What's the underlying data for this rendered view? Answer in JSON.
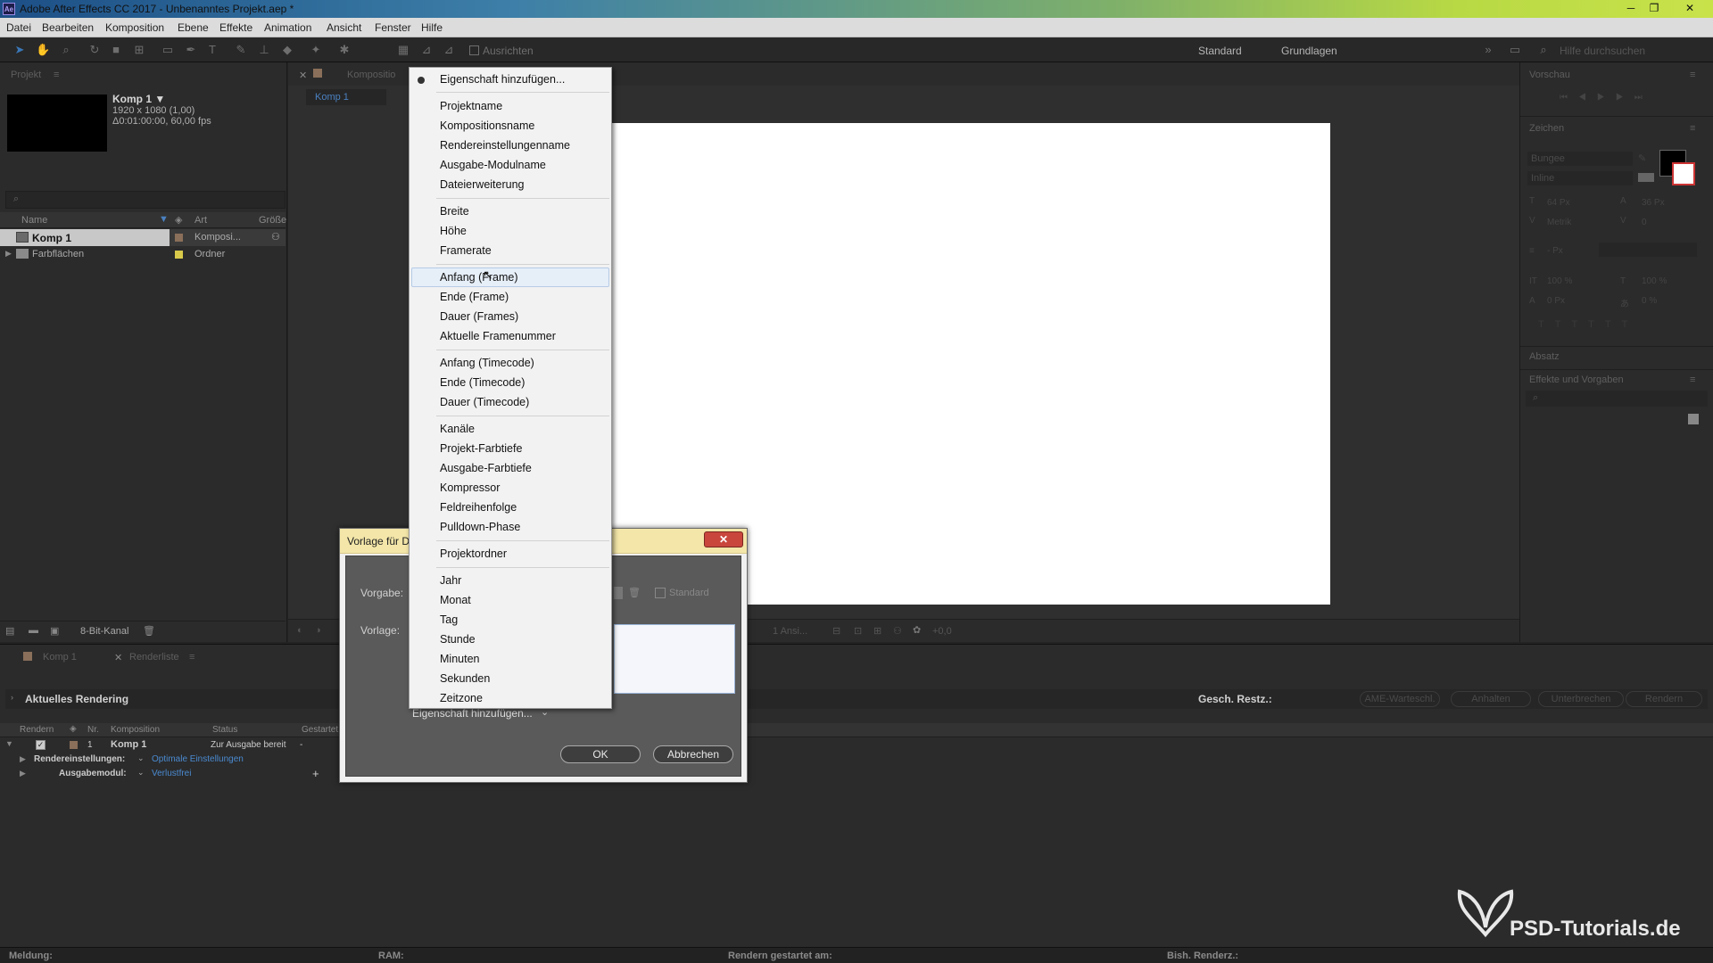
{
  "window": {
    "title": "Adobe After Effects CC 2017 - Unbenanntes Projekt.aep *",
    "app_icon": "Ae"
  },
  "menubar": [
    "Datei",
    "Bearbeiten",
    "Komposition",
    "Ebene",
    "Effekte",
    "Animation",
    "Ansicht",
    "Fenster",
    "Hilfe"
  ],
  "toolbar": {
    "ausrichten": "Ausrichten",
    "workspace_standard": "Standard",
    "workspace_grundlagen": "Grundlagen",
    "help_placeholder": "Hilfe durchsuchen"
  },
  "project": {
    "title": "Projekt",
    "comp_name": "Komp 1 ▼",
    "comp_size": "1920 x 1080 (1,00)",
    "comp_duration": "Δ0:01:00:00, 60,00 fps",
    "col_name": "Name",
    "col_art": "Art",
    "col_groesse": "Größe",
    "rows": [
      {
        "name": "Komp 1",
        "type": "Komposi...",
        "color": "#8a6f5a"
      },
      {
        "name": "Farbflächen",
        "type": "Ordner",
        "color": "#d8c94a"
      }
    ],
    "bit_depth": "8-Bit-Kanal"
  },
  "viewer": {
    "tab_label": "Kompositio",
    "comp_tab": "Komp 1",
    "zoom_view": "1 Ansi...",
    "exposure": "+0,0"
  },
  "right": {
    "vorschau": "Vorschau",
    "zeichen": "Zeichen",
    "font": "Bungee",
    "style": "Inline",
    "size": "64 Px",
    "leading": "36 Px",
    "kerning": "Metrik",
    "tracking": "0",
    "stroke": "- Px",
    "vscale": "100 %",
    "hscale": "100 %",
    "baseline": "0 Px",
    "tsume": "0 %",
    "absatz": "Absatz",
    "effekte": "Effekte und Vorgaben"
  },
  "renderq": {
    "tab1": "Komp 1",
    "tab2": "Renderliste",
    "current": "Aktuelles Rendering",
    "rest": "Gesch. Restz.:",
    "btn_ame": "AME-Warteschl.",
    "btn_anhalten": "Anhalten",
    "btn_unterbrechen": "Unterbrechen",
    "btn_rendern": "Rendern",
    "col_render": "Rendern",
    "col_nr": "Nr.",
    "col_komposition": "Komposition",
    "col_status": "Status",
    "col_gestartet": "Gestartet",
    "item_nr": "1",
    "item_name": "Komp 1",
    "item_status": "Zur Ausgabe bereit",
    "item_dash": "-",
    "render_settings_label": "Rendereinstellungen:",
    "render_settings_value": "Optimale Einstellungen",
    "output_label": "Ausgabemodul:",
    "output_value": "Verlustfrei"
  },
  "status": {
    "meldung": "Meldung:",
    "ram": "RAM:",
    "gestartet": "Rendern gestartet am:",
    "bisher": "Bish. Renderz.:"
  },
  "dialog": {
    "title": "Vorlage für D",
    "vorgabe_label": "Vorgabe:",
    "vorlage_label": "Vorlage:",
    "standard_label": "Standard",
    "add_property": "Eigenschaft hinzufügen...",
    "ok": "OK",
    "cancel": "Abbrechen"
  },
  "menu": {
    "header": "Eigenschaft hinzufügen...",
    "groups": [
      [
        "Projektname",
        "Kompositionsname",
        "Rendereinstellungenname",
        "Ausgabe-Modulname",
        "Dateierweiterung"
      ],
      [
        "Breite",
        "Höhe",
        "Framerate"
      ],
      [
        "Anfang (Frame)",
        "Ende (Frame)",
        "Dauer (Frames)",
        "Aktuelle Framenummer"
      ],
      [
        "Anfang (Timecode)",
        "Ende (Timecode)",
        "Dauer (Timecode)"
      ],
      [
        "Kanäle",
        "Projekt-Farbtiefe",
        "Ausgabe-Farbtiefe",
        "Kompressor",
        "Feldreihenfolge",
        "Pulldown-Phase"
      ],
      [
        "Projektordner"
      ],
      [
        "Jahr",
        "Monat",
        "Tag",
        "Stunde",
        "Minuten",
        "Sekunden",
        "Zeitzone"
      ]
    ],
    "highlighted": "Anfang (Frame)"
  },
  "watermark": "PSD-Tutorials.de"
}
